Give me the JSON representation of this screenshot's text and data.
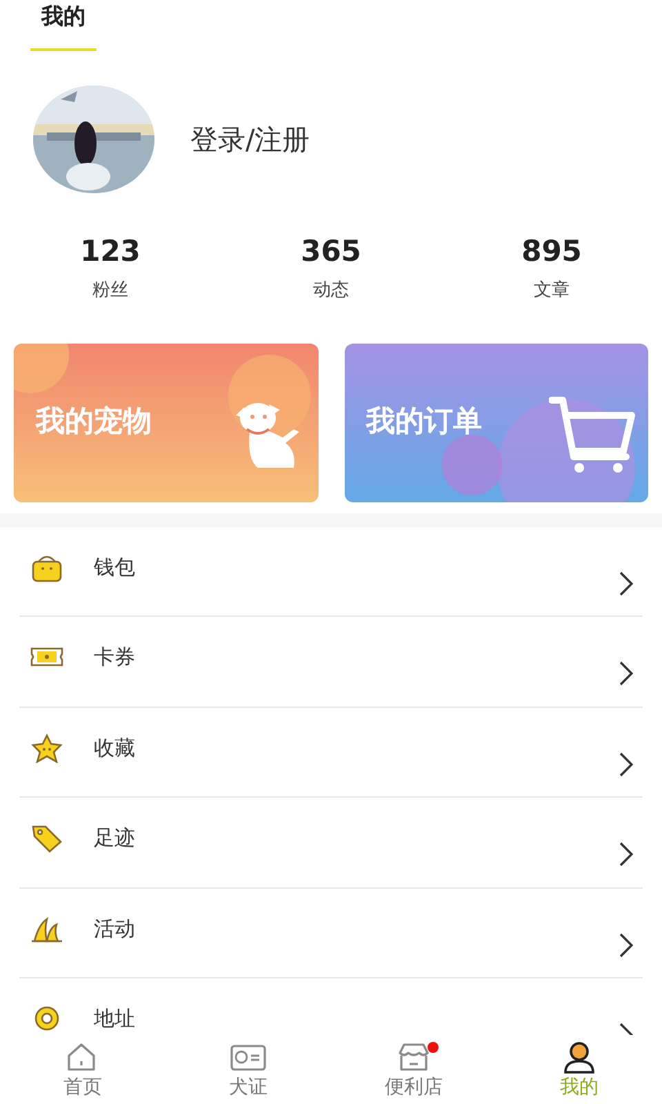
{
  "header": {
    "tabs": [
      {
        "label": "我的",
        "selected": true
      }
    ]
  },
  "profile": {
    "login": "登录/注册"
  },
  "stats": [
    {
      "value": "123",
      "label": "粉丝"
    },
    {
      "value": "365",
      "label": "动态"
    },
    {
      "value": "895",
      "label": "文章"
    }
  ],
  "cards": [
    {
      "kind": "pets",
      "label": "我的宠物"
    },
    {
      "kind": "orders",
      "label": "我的订单"
    }
  ],
  "menu": [
    {
      "label": "钱包"
    },
    {
      "label": "卡券"
    },
    {
      "label": "收藏"
    },
    {
      "label": "足迹"
    },
    {
      "label": "活动"
    },
    {
      "label": "地址"
    }
  ],
  "tab_bar": [
    {
      "label": "首页",
      "selected": false,
      "dot": false
    },
    {
      "label": "犬证",
      "selected": false,
      "dot": false
    },
    {
      "label": "便利店",
      "selected": false,
      "dot": true
    },
    {
      "label": "我的",
      "selected": true,
      "dot": false
    }
  ]
}
